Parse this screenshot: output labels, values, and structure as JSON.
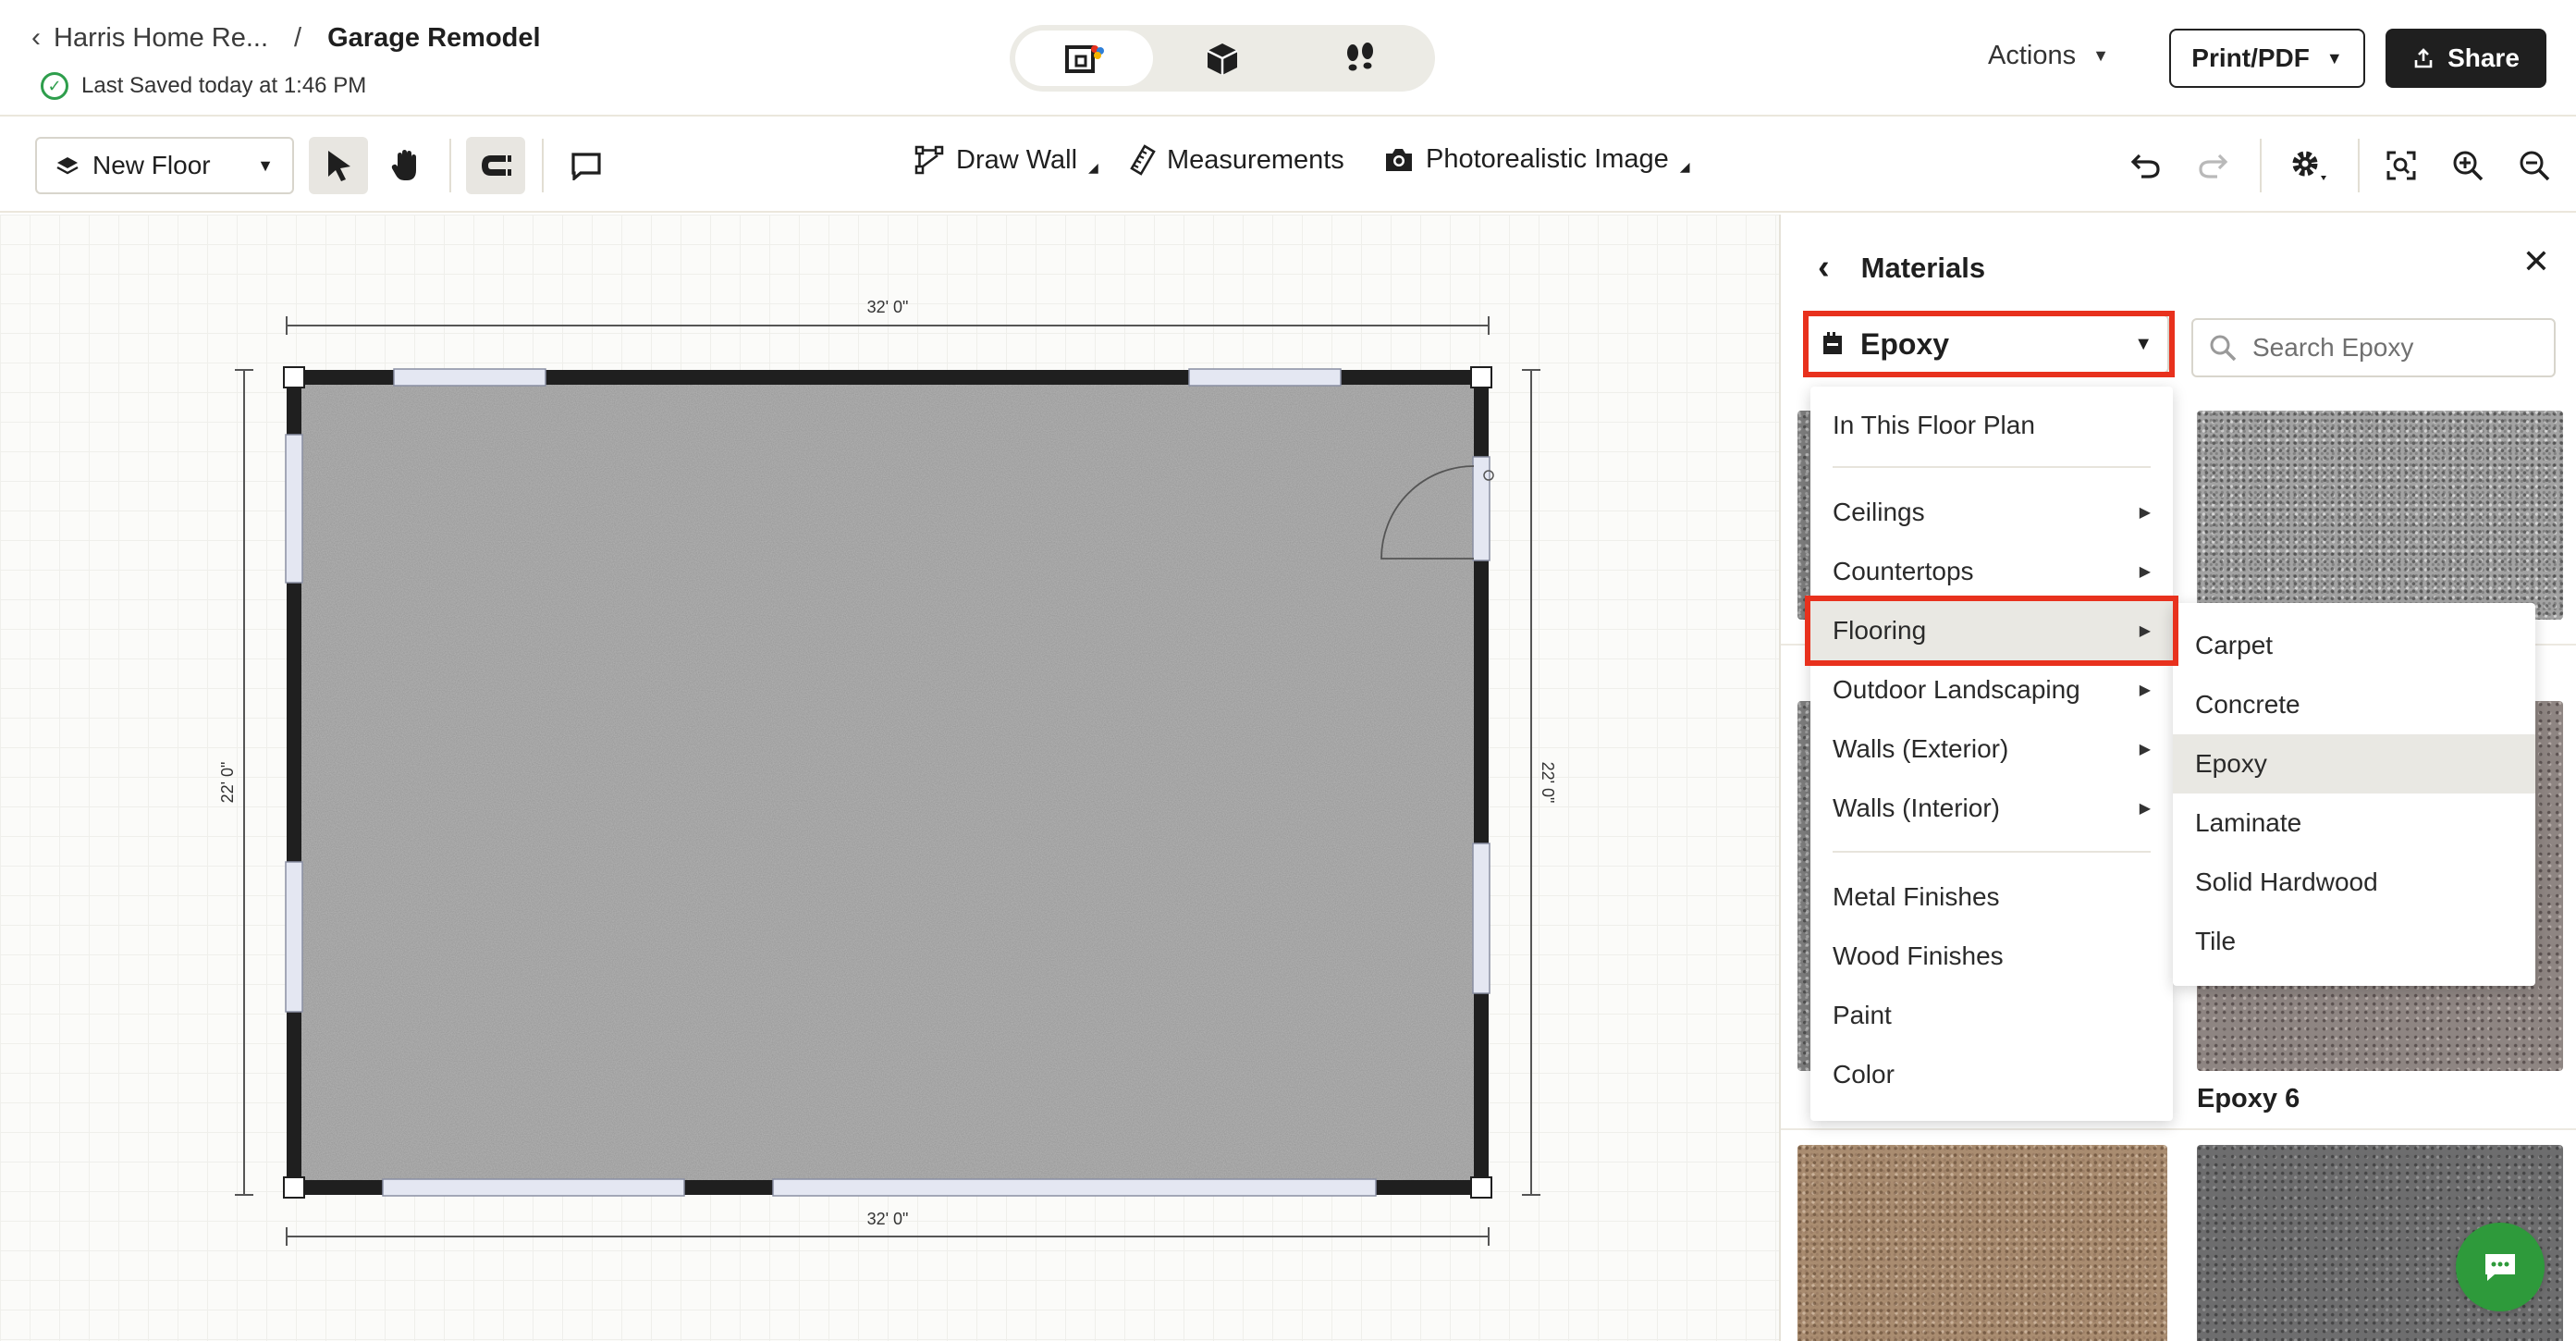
{
  "header": {
    "parent_project": "Harris Home Re...",
    "separator": "/",
    "current_project": "Garage Remodel",
    "saved_status": "Last Saved today at 1:46 PM",
    "actions_label": "Actions",
    "print_label": "Print/PDF",
    "share_label": "Share",
    "view_modes": [
      "2d-floorplan-icon",
      "3d-box-icon",
      "walkthrough-footsteps-icon"
    ],
    "active_view": "2d-floorplan-icon"
  },
  "toolbar": {
    "floor_label": "New Floor",
    "draw_wall_label": "Draw Wall",
    "measurements_label": "Measurements",
    "photorealistic_label": "Photorealistic Image"
  },
  "plan": {
    "top_dimension": "32' 0\"",
    "bottom_dimension": "32' 0\"",
    "left_dimension": "22' 0\"",
    "right_dimension": "22' 0\""
  },
  "materials": {
    "title": "Materials",
    "selected_category": "Epoxy",
    "search_placeholder": "Search Epoxy",
    "swatch_label": "Epoxy 6",
    "category_menu": {
      "top_item": "In This Floor Plan",
      "with_submenu": [
        "Ceilings",
        "Countertops",
        "Flooring",
        "Outdoor Landscaping",
        "Walls (Exterior)",
        "Walls (Interior)"
      ],
      "plain": [
        "Metal Finishes",
        "Wood Finishes",
        "Paint",
        "Color"
      ],
      "highlighted": "Flooring"
    },
    "flooring_submenu": [
      "Carpet",
      "Concrete",
      "Epoxy",
      "Laminate",
      "Solid Hardwood",
      "Tile"
    ],
    "selected_flooring": "Epoxy"
  },
  "colors": {
    "highlight_red": "#e8311d",
    "saved_green": "#2e9e4c",
    "chat_green": "#2e9a3b",
    "wall_black": "#1f1f1f",
    "window_fill": "#e4e7f2"
  }
}
